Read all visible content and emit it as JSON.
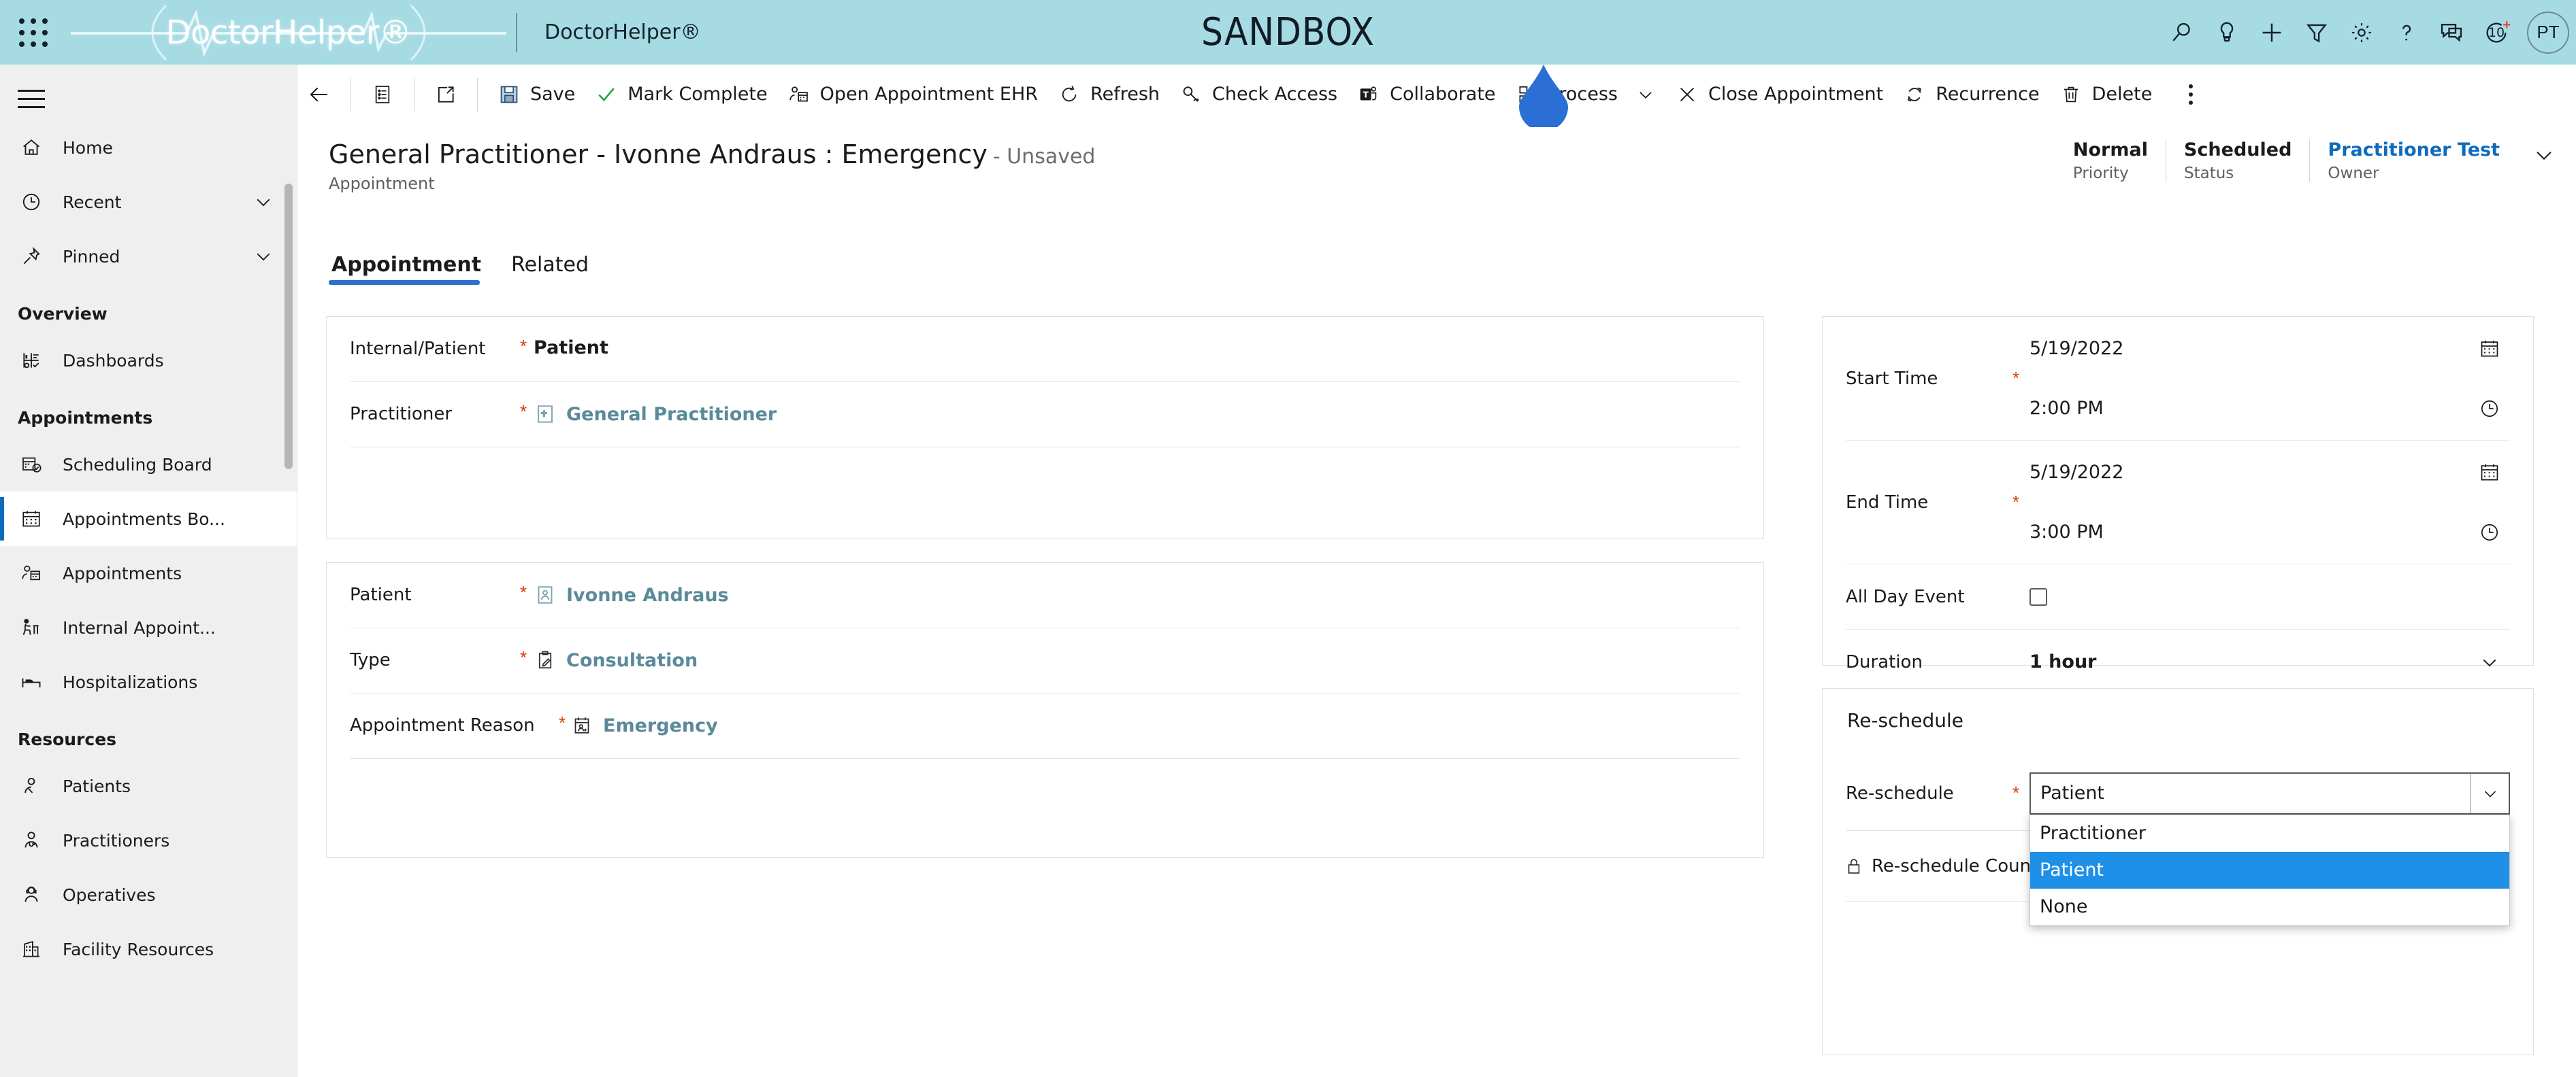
{
  "topbar": {
    "waffle_label": "app-launcher",
    "logo_text": "DoctorHelper®",
    "app_name": "DoctorHelper®",
    "environment_label": "SANDBOX",
    "brand_color": "#a6dbe4",
    "icons": [
      {
        "name": "search-icon",
        "label": "Search"
      },
      {
        "name": "lightbulb-icon",
        "label": "Assistant"
      },
      {
        "name": "plus-icon",
        "label": "Quick create"
      },
      {
        "name": "filter-icon",
        "label": "Filter"
      },
      {
        "name": "gear-icon",
        "label": "Settings"
      },
      {
        "name": "help-icon",
        "label": "Help"
      },
      {
        "name": "feedback-icon",
        "label": "Feedback"
      },
      {
        "name": "notifications-icon",
        "label": "Notifications"
      }
    ],
    "notification_badge": "10",
    "notification_plus": "+",
    "avatar_initials": "PT"
  },
  "sidebar": {
    "hamburger_label": "Site map",
    "items": [
      {
        "name": "home",
        "label": "Home",
        "icon": "home-icon",
        "chevron": false,
        "active": false
      },
      {
        "name": "recent",
        "label": "Recent",
        "icon": "clock-icon",
        "chevron": true,
        "active": false
      },
      {
        "name": "pinned",
        "label": "Pinned",
        "icon": "pin-icon",
        "chevron": true,
        "active": false
      }
    ],
    "groups": [
      {
        "title": "Overview",
        "items": [
          {
            "name": "dashboards",
            "label": "Dashboards",
            "icon": "dashboard-icon",
            "active": false
          }
        ]
      },
      {
        "title": "Appointments",
        "items": [
          {
            "name": "scheduling-board",
            "label": "Scheduling Board",
            "icon": "calendar-check-icon",
            "active": false
          },
          {
            "name": "appointments-board",
            "label": "Appointments Bo...",
            "icon": "calendar-icon",
            "active": true
          },
          {
            "name": "appointments",
            "label": "Appointments",
            "icon": "person-calendar-icon",
            "active": false
          },
          {
            "name": "internal-appointments",
            "label": "Internal Appoint...",
            "icon": "person-desk-icon",
            "active": false
          },
          {
            "name": "hospitalizations",
            "label": "Hospitalizations",
            "icon": "bed-icon",
            "active": false
          }
        ]
      },
      {
        "title": "Resources",
        "items": [
          {
            "name": "patients",
            "label": "Patients",
            "icon": "patient-icon",
            "active": false
          },
          {
            "name": "practitioners",
            "label": "Practitioners",
            "icon": "doctor-icon",
            "active": false
          },
          {
            "name": "operatives",
            "label": "Operatives",
            "icon": "headset-person-icon",
            "active": false
          },
          {
            "name": "facility-resources",
            "label": "Facility Resources",
            "icon": "building-icon",
            "active": false
          }
        ]
      }
    ]
  },
  "commandbar": {
    "back_label": "Back",
    "list_label": "Show as list",
    "popout_label": "Open in new window",
    "buttons": [
      {
        "name": "save",
        "label": "Save",
        "icon": "save-icon"
      },
      {
        "name": "mark-complete",
        "label": "Mark Complete",
        "icon": "check-icon"
      },
      {
        "name": "open-appointment-ehr",
        "label": "Open Appointment EHR",
        "icon": "person-calendar-icon"
      },
      {
        "name": "refresh",
        "label": "Refresh",
        "icon": "refresh-icon"
      },
      {
        "name": "check-access",
        "label": "Check Access",
        "icon": "key-icon"
      },
      {
        "name": "collaborate",
        "label": "Collaborate",
        "icon": "teams-icon"
      },
      {
        "name": "process",
        "label": "Process",
        "icon": "process-icon",
        "chevron": true
      },
      {
        "name": "close-appointment",
        "label": "Close Appointment",
        "icon": "close-icon"
      },
      {
        "name": "recurrence",
        "label": "Recurrence",
        "icon": "recurrence-icon"
      },
      {
        "name": "delete",
        "label": "Delete",
        "icon": "trash-icon"
      }
    ],
    "overflow_label": "More commands"
  },
  "record_header": {
    "title": "General Practitioner - Ivonne Andraus : Emergency",
    "unsaved": "- Unsaved",
    "entity": "Appointment",
    "fields": [
      {
        "name": "priority",
        "value": "Normal",
        "label": "Priority",
        "link": false
      },
      {
        "name": "status",
        "value": "Scheduled",
        "label": "Status",
        "link": false
      },
      {
        "name": "owner",
        "value": "Practitioner Test",
        "label": "Owner",
        "link": true
      }
    ],
    "expand_label": "Expand header"
  },
  "tabs": [
    {
      "name": "appointment",
      "label": "Appointment",
      "active": true
    },
    {
      "name": "related",
      "label": "Related",
      "active": false
    }
  ],
  "form": {
    "general": {
      "rows": [
        {
          "name": "internal-patient",
          "label": "Internal/Patient",
          "required": true,
          "value": "Patient",
          "type": "text"
        },
        {
          "name": "practitioner",
          "label": "Practitioner",
          "required": true,
          "value": "General Practitioner",
          "type": "lookup",
          "icon": "practitioner-record-icon"
        }
      ]
    },
    "details": {
      "rows": [
        {
          "name": "patient",
          "label": "Patient",
          "required": true,
          "value": "Ivonne Andraus",
          "type": "lookup",
          "icon": "patient-record-icon"
        },
        {
          "name": "type",
          "label": "Type",
          "required": true,
          "value": "Consultation",
          "type": "lookup",
          "icon": "clipboard-icon"
        },
        {
          "name": "appointment-reason",
          "label": "Appointment Reason",
          "required": true,
          "value": "Emergency",
          "type": "lookup",
          "icon": "calendar-person-icon"
        }
      ]
    },
    "schedule": {
      "start_time": {
        "label": "Start Time",
        "required": true,
        "date": "5/19/2022",
        "time": "2:00 PM",
        "date_icon": "calendar-icon",
        "time_icon": "clock-icon"
      },
      "end_time": {
        "label": "End Time",
        "required": true,
        "date": "5/19/2022",
        "time": "3:00 PM",
        "date_icon": "calendar-icon",
        "time_icon": "clock-icon"
      },
      "all_day_event": {
        "label": "All Day Event",
        "checked": false
      },
      "duration": {
        "label": "Duration",
        "value": "1 hour"
      }
    },
    "reschedule": {
      "panel_title": "Re-schedule",
      "field_label": "Re-schedule",
      "required": true,
      "selected": "Patient",
      "options": [
        "Practitioner",
        "Patient",
        "None"
      ],
      "highlight_color": "#1e90e8",
      "counter_label": "Re-schedule Counter",
      "counter_locked": true
    }
  }
}
